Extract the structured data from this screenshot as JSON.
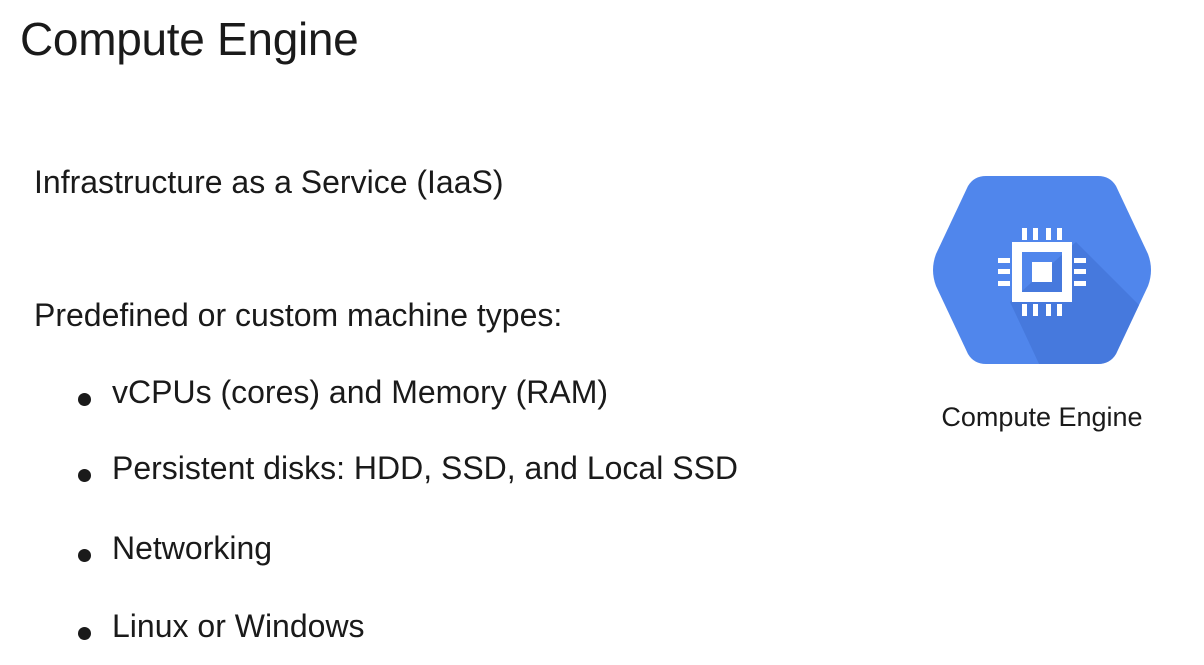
{
  "slide": {
    "title": "Compute Engine",
    "lines": {
      "iaas": "Infrastructure as a Service (IaaS)",
      "machine_types": "Predefined or custom machine types:"
    },
    "bullets": [
      "vCPUs (cores) and Memory (RAM)",
      "Persistent disks: HDD, SSD, and Local SSD",
      "Networking",
      "Linux or Windows"
    ]
  },
  "logo": {
    "icon": "compute-engine-chip-icon",
    "caption": "Compute Engine",
    "colors": {
      "hexagon": "#5086ec",
      "shadow": "#3e6fd1",
      "chip": "#ffffff"
    }
  }
}
